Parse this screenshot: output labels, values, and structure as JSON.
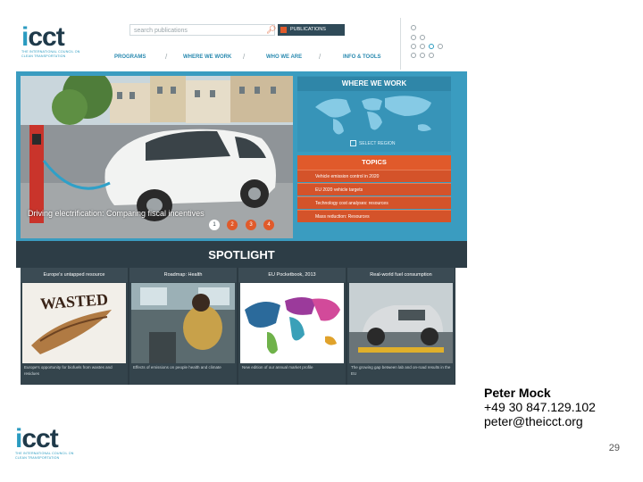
{
  "header": {
    "logo_text_1": "i",
    "logo_text_2": "cct",
    "logo_sub": "THE INTERNATIONAL COUNCIL ON CLEAN TRANSPORTATION",
    "search_placeholder": "search publications",
    "publications_button": "PUBLICATIONS",
    "nav": [
      "PROGRAMS",
      "WHERE WE WORK",
      "WHO WE ARE",
      "INFO & TOOLS"
    ]
  },
  "hero": {
    "caption": "Driving electrification: Comparing fiscal incentives",
    "pager": [
      "1",
      "2",
      "3",
      "4"
    ],
    "where_title": "WHERE WE WORK",
    "select_region": "SELECT REGION",
    "topics_title": "TOPICS",
    "topics": [
      "Vehicle emission control in 2020",
      "EU 2020 vehicle targets",
      "Technology cost analyses: resources",
      "Mass reduction: Resources"
    ]
  },
  "spotlight": {
    "title": "SPOTLIGHT",
    "cards": [
      {
        "title": "Europe's untapped resource",
        "desc": "Europe's opportunity for biofuels from wastes and residues",
        "img_text": "WASTED"
      },
      {
        "title": "Roadmap: Health",
        "desc": "Effects of emissions on people health and climate"
      },
      {
        "title": "EU Pocketbook, 2013",
        "desc": "New edition of our annual market profile"
      },
      {
        "title": "Real-world fuel consumption",
        "desc": "The growing gap between lab and on-road results in the EU"
      }
    ]
  },
  "contact": {
    "name": "Peter Mock",
    "phone": "+49 30 847.129.102",
    "email": "peter@theicct.org"
  },
  "slide_number": "29",
  "colors": {
    "teal": "#3a9cc0",
    "orange": "#e05a2b",
    "dark": "#2d3d46",
    "logo_dark": "#1f3a4a",
    "logo_blue": "#2a9bc0"
  },
  "icons": [
    "search-icon",
    "checkbox-icon",
    "world-map-icon",
    "dots-logo-icon"
  ]
}
